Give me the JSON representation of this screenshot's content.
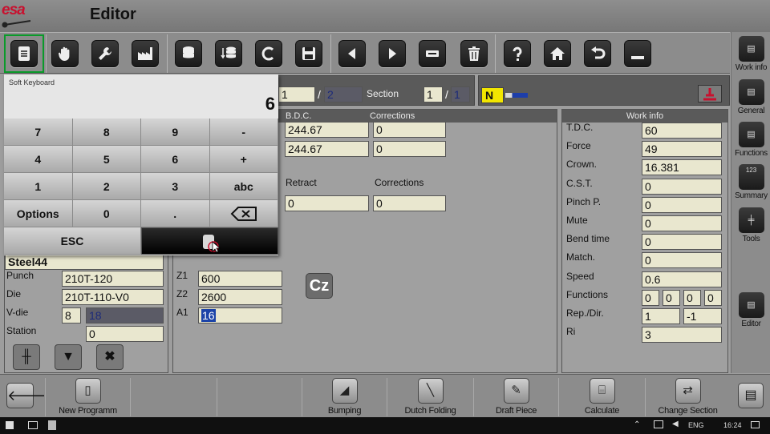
{
  "app": {
    "logo_text": "esa",
    "title": "Editor"
  },
  "keyboard": {
    "title": "Soft Keyboard",
    "value": "6",
    "rows": [
      [
        "7",
        "8",
        "9",
        "-"
      ],
      [
        "4",
        "5",
        "6",
        "+"
      ],
      [
        "1",
        "2",
        "3",
        "abc"
      ],
      [
        "Options",
        "0",
        ".",
        ""
      ]
    ],
    "esc_label": "ESC"
  },
  "header_strip": {
    "bend_current": "1",
    "bend_sep": "/",
    "bend_total": "2",
    "section_label": "Section",
    "section_current": "1",
    "section_sep": "/",
    "section_total": "1",
    "mode": "N"
  },
  "axes": {
    "bdc_label": "B.D.C.",
    "corrections_label": "Corrections",
    "bdc_values": [
      "244.67",
      "244.67"
    ],
    "corrections_values": [
      "0",
      "0"
    ],
    "retract_label": "Retract",
    "retract_corrections_label": "Corrections",
    "retract_value": "0",
    "retract_corrections_value": "0",
    "z1_label": "Z1",
    "z1": "600",
    "z2_label": "Z2",
    "z2": "2600",
    "a1_label": "A1",
    "a1": "16"
  },
  "tooling": {
    "material": "Steel44",
    "punch_label": "Punch",
    "punch": "210T-120",
    "die_label": "Die",
    "die": "210T-110-V0",
    "vdie_label": "V-die",
    "vdie_a": "8",
    "vdie_b": "18",
    "station_label": "Station",
    "station": "0"
  },
  "work_info": {
    "header": "Work info",
    "rows": [
      {
        "label": "T.D.C.",
        "value": "60"
      },
      {
        "label": "Force",
        "value": "49"
      },
      {
        "label": "Crown.",
        "value": "16.381"
      },
      {
        "label": "C.S.T.",
        "value": "0"
      },
      {
        "label": "Pinch P.",
        "value": "0"
      },
      {
        "label": "Mute",
        "value": "0"
      },
      {
        "label": "Bend time",
        "value": "0"
      },
      {
        "label": "Match.",
        "value": "0"
      },
      {
        "label": "Speed",
        "value": "0.6"
      }
    ],
    "functions_label": "Functions",
    "functions": [
      "0",
      "0",
      "0",
      "0"
    ],
    "repdir_label": "Rep./Dir.",
    "rep": "1",
    "dir": "-1",
    "ri_label": "Ri",
    "ri": "3"
  },
  "right_nav": [
    {
      "label": "Work info",
      "icon": "document-icon"
    },
    {
      "label": "General",
      "icon": "document-icon"
    },
    {
      "label": "Functions",
      "icon": "document-icon"
    },
    {
      "label": "Summary",
      "icon": "summary-icon",
      "badge": "123"
    },
    {
      "label": "Tools",
      "icon": "tools-icon"
    },
    {
      "label": "Editor",
      "icon": "editor-icon"
    }
  ],
  "bottom_nav": [
    "New Programm",
    "Bumping",
    "Dutch Folding",
    "Draft Piece",
    "Calculate",
    "Change Section"
  ],
  "taskbar": {
    "language": "ENG",
    "time": "16:24"
  },
  "cz_label": "Cz",
  "colors": {
    "accent_red": "#c8102e",
    "selection_green": "#0a9a2a",
    "field_bg": "#e9e7cf",
    "mode_yellow": "#f2e600"
  }
}
